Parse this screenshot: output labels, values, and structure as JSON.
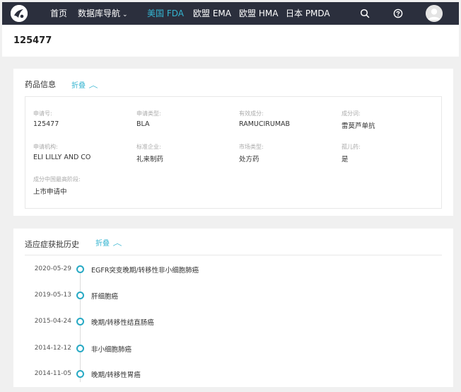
{
  "nav": {
    "items": [
      {
        "label": "首页"
      },
      {
        "label": "数据库导航",
        "caret": "⌄"
      },
      {
        "label": "美国 FDA"
      },
      {
        "label": "欧盟 EMA"
      },
      {
        "label": "欧盟 HMA"
      },
      {
        "label": "日本 PMDA"
      }
    ],
    "active_index": 2,
    "icons": [
      "logo-icon",
      "search-icon",
      "help-icon",
      "avatar-icon"
    ]
  },
  "page": {
    "title": "125477"
  },
  "drug_info": {
    "heading": "药品信息",
    "fold_label": "折叠",
    "fold_icon": "chevron-up-icon",
    "fields": [
      {
        "label": "申请号:",
        "value": "125477"
      },
      {
        "label": "申请类型:",
        "value": "BLA"
      },
      {
        "label": "有效成分:",
        "value": "RAMUCIRUMAB"
      },
      {
        "label": "成分词:",
        "value": "雷莫芦单抗"
      },
      {
        "label": "申请机构:",
        "value": "ELI LILLY AND CO"
      },
      {
        "label": "标准企业:",
        "value": "礼来制药"
      },
      {
        "label": "市场类型:",
        "value": "处方药"
      },
      {
        "label": "孤儿药:",
        "value": "是"
      },
      {
        "label": "成分中国最高阶段:",
        "value": "上市申请中"
      }
    ]
  },
  "history": {
    "heading": "适应症获批历史",
    "fold_label": "折叠",
    "fold_icon": "chevron-up-icon",
    "entries": [
      {
        "date": "2020-05-29",
        "text": "EGFR突变晚期/转移性非小细胞肺癌"
      },
      {
        "date": "2019-05-13",
        "text": "肝细胞癌"
      },
      {
        "date": "2015-04-24",
        "text": "晚期/转移性结直肠癌"
      },
      {
        "date": "2014-12-12",
        "text": "非小细胞肺癌"
      },
      {
        "date": "2014-11-05",
        "text": "晚期/转移性胃癌"
      }
    ]
  },
  "colors": {
    "nav_bg": "#2b2f3d",
    "accent": "#34b4d0",
    "page_bg": "#f0f0f0"
  }
}
